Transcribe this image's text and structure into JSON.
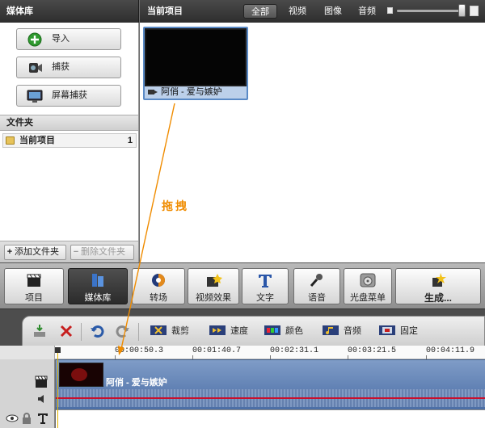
{
  "library": {
    "title": "媒体库"
  },
  "project": {
    "title": "当前项目"
  },
  "filters": [
    {
      "label": "全部",
      "active": true
    },
    {
      "label": "视频",
      "active": false
    },
    {
      "label": "图像",
      "active": false
    },
    {
      "label": "音频",
      "active": false
    }
  ],
  "zoom": {
    "level": 0.95
  },
  "left_buttons": [
    {
      "label": "导入",
      "icon": "add-circle-icon"
    },
    {
      "label": "捕获",
      "icon": "camcorder-icon"
    },
    {
      "label": "屏幕捕获",
      "icon": "screen-rec-icon"
    }
  ],
  "folders": {
    "header": "文件夹",
    "items": [
      {
        "name": "当前项目",
        "count": "1"
      }
    ]
  },
  "folder_actions": {
    "add": "添加文件夹",
    "remove": "删除文件夹"
  },
  "media": {
    "caption": "阿俏 - 爱与嫉妒"
  },
  "drag_label": "拖拽",
  "main_toolbar": [
    {
      "label": "项目",
      "icon": "clapper-icon",
      "active": false
    },
    {
      "label": "媒体库",
      "icon": "media-library-icon",
      "active": true
    },
    {
      "label": "转场",
      "icon": "transition-icon",
      "active": false
    },
    {
      "label": "视频效果",
      "icon": "video-effects-icon",
      "active": false
    },
    {
      "label": "文字",
      "icon": "text-icon",
      "active": false
    },
    {
      "label": "语音",
      "icon": "microphone-icon",
      "active": false
    },
    {
      "label": "光盘菜单",
      "icon": "disc-menu-icon",
      "active": false
    },
    {
      "label": "生成...",
      "icon": "produce-icon",
      "active": false
    }
  ],
  "edit_toolbar": {
    "tools": [
      {
        "label": "裁剪",
        "icon": "crop-icon"
      },
      {
        "label": "速度",
        "icon": "speed-icon"
      },
      {
        "label": "颜色",
        "icon": "color-icon"
      },
      {
        "label": "音频",
        "icon": "audio-icon"
      },
      {
        "label": "固定",
        "icon": "freeze-icon"
      }
    ]
  },
  "ruler": {
    "ticks": [
      "00:00:50.3",
      "00:01:40.7",
      "00:02:31.1",
      "00:03:21.5",
      "00:04:11.9"
    ]
  },
  "timeline": {
    "clip_title": "阿俏 - 爱与嫉妒"
  },
  "colors": {
    "accent": "#f08c00",
    "track": "#5b7db3",
    "audio_line": "#c8102e"
  }
}
